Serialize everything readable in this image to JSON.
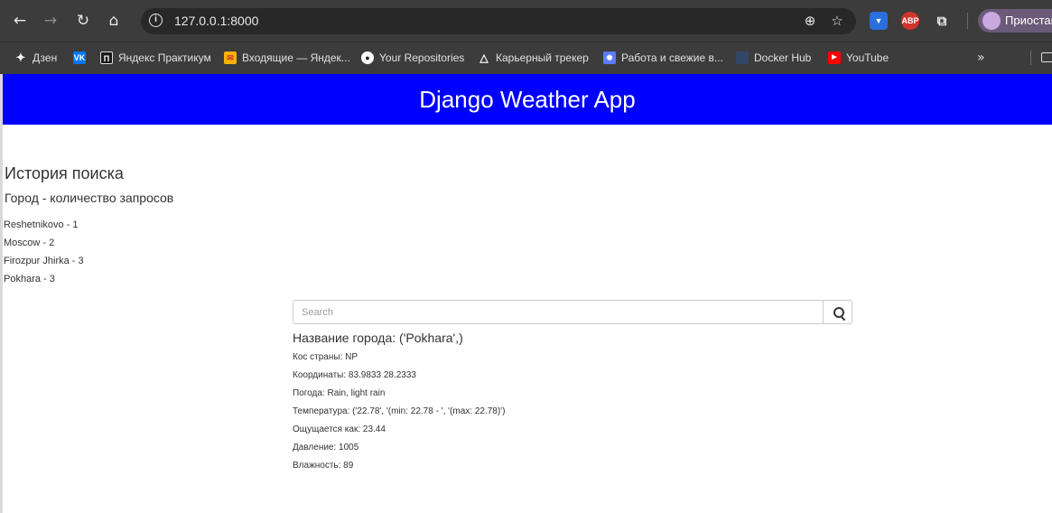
{
  "browser": {
    "url": "127.0.0.1:8000",
    "profile_label": "Приостан",
    "bookmarks": [
      {
        "label": "Дзен",
        "icon": "dzen-icon",
        "color": "#ffffff"
      },
      {
        "label": "",
        "icon": "vk-icon",
        "color": "#0077ff"
      },
      {
        "label": "Яндекс Практикум",
        "icon": "praktikum-icon",
        "color": "#1a1a1a"
      },
      {
        "label": "Входящие — Яндек...",
        "icon": "yandex-mail-icon",
        "color": "#f5b400"
      },
      {
        "label": "Your Repositories",
        "icon": "github-icon",
        "color": "#ffffff"
      },
      {
        "label": "Карьерный трекер",
        "icon": "triangle-icon",
        "color": "#ffffff"
      },
      {
        "label": "Работа и свежие в...",
        "icon": "work-icon",
        "color": "#5b7cfa"
      },
      {
        "label": "Docker Hub",
        "icon": "docker-icon",
        "color": "#1d63ed"
      },
      {
        "label": "YouTube",
        "icon": "youtube-icon",
        "color": "#ff0000"
      }
    ]
  },
  "app": {
    "title": "Django Weather App"
  },
  "history": {
    "title": "История поиска",
    "subtitle": "Город - количество запросов",
    "items": [
      "Reshetnikovo - 1",
      "Moscow - 2",
      "Firozpur Jhirka - 3",
      "Pokhara - 3"
    ]
  },
  "search": {
    "placeholder": "Search",
    "value": ""
  },
  "result": {
    "city_title": "Название города: ('Pokhara',)",
    "lines": [
      "Кос страны: NP",
      "Координаты: 83.9833 28.2333",
      "Погода: Rain, light rain",
      "Температура: ('22.78', '(min: 22.78 - ', '(max: 22.78)')",
      "Ощущается как: 23.44",
      "Давление: 1005",
      "Влажность: 89"
    ]
  },
  "colors": {
    "header_bg": "#0000ff",
    "chrome_bg": "#3c3c3c"
  }
}
